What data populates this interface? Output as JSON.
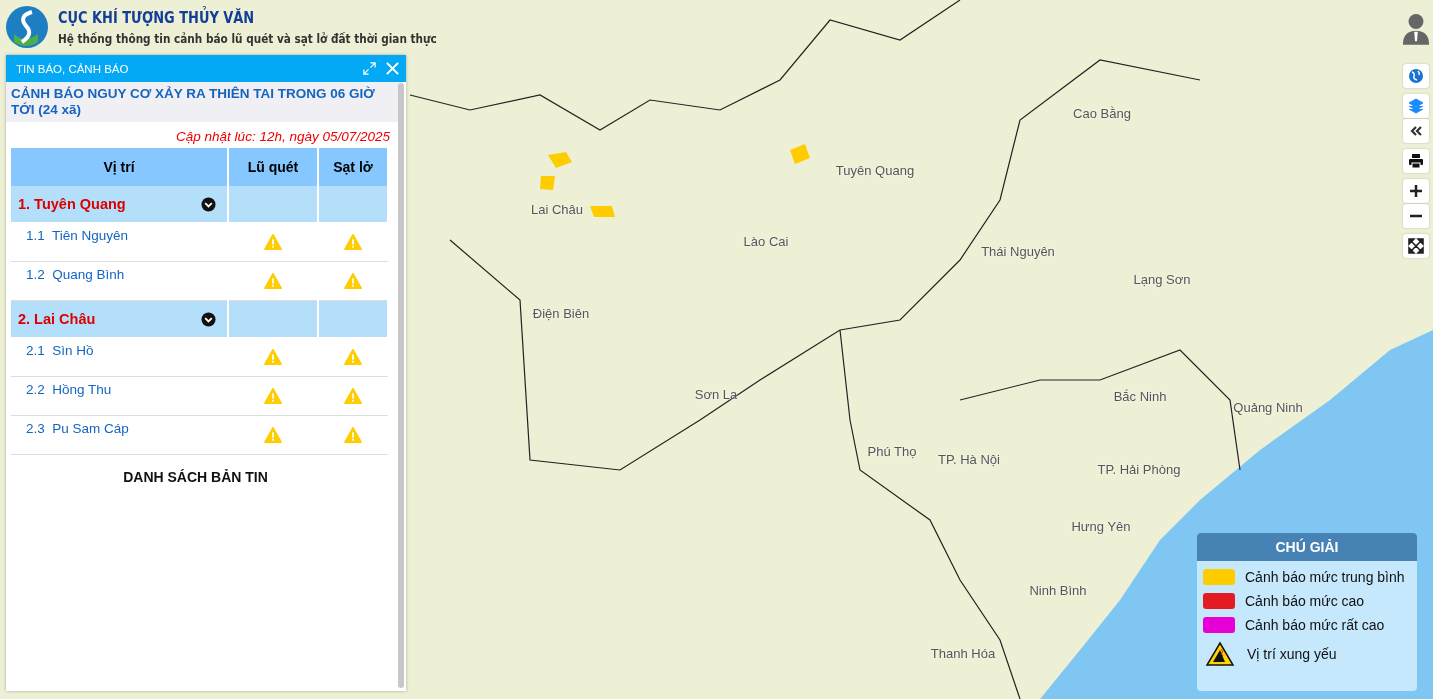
{
  "header": {
    "title": "CỤC KHÍ TƯỢNG THỦY VĂN",
    "subtitle": "Hệ thống thông tin cảnh báo lũ quét và sạt lở đất thời gian thực"
  },
  "panel": {
    "title": "TIN BÁO, CẢNH BÁO",
    "heading": "CẢNH BÁO NGUY CƠ XẢY RA THIÊN TAI TRONG 06 GIỜ TỚI (24 xã)",
    "updated": "Cập nhật lúc: 12h, ngày 05/07/2025",
    "table": {
      "columns": [
        "Vị trí",
        "Lũ quét",
        "Sạt lở"
      ],
      "groups": [
        {
          "name": "1. Tuyên Quang",
          "expanded": true,
          "rows": [
            {
              "name": "1.1  Tiên Nguyên",
              "flash_flood": true,
              "landslide": true
            },
            {
              "name": "1.2  Quang Bình",
              "flash_flood": true,
              "landslide": true
            }
          ]
        },
        {
          "name": "2. Lai Châu",
          "expanded": true,
          "rows": [
            {
              "name": "2.1  Sìn Hồ",
              "flash_flood": true,
              "landslide": true
            },
            {
              "name": "2.2  Hồng Thu",
              "flash_flood": true,
              "landslide": true
            },
            {
              "name": "2.3  Pu Sam Cáp",
              "flash_flood": true,
              "landslide": true
            }
          ]
        }
      ]
    },
    "footer_link": "DANH SÁCH BẢN TIN"
  },
  "map": {
    "labels": [
      "Cao Bằng",
      "Tuyên Quang",
      "Lai Châu",
      "Lào Cai",
      "Thái Nguyên",
      "Lạng Sơn",
      "Điện Biên",
      "Sơn La",
      "Bắc Ninh",
      "Quảng Ninh",
      "Phú Thọ",
      "TP. Hà Nội",
      "TP. Hải Phòng",
      "Hưng Yên",
      "Ninh Bình",
      "Thanh Hóa"
    ]
  },
  "legend": {
    "title": "CHÚ GIẢI",
    "items": [
      {
        "kind": "swatch",
        "label": "Cảnh báo mức trung bình",
        "color": "#ffcc00"
      },
      {
        "kind": "swatch",
        "label": "Cảnh báo mức cao",
        "color": "#e31b23"
      },
      {
        "kind": "swatch",
        "label": "Cảnh báo mức rất cao",
        "color": "#e600d6"
      },
      {
        "kind": "hazard",
        "label": "Vị trí xung yếu"
      }
    ]
  }
}
